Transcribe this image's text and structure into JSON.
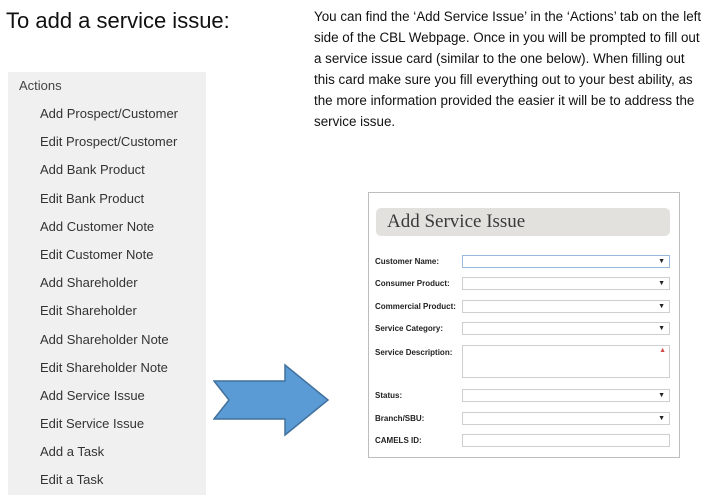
{
  "heading": "To add a service issue:",
  "intro": "You can find the ‘Add Service Issue’ in the ‘Actions’ tab on the left side of the CBL Webpage. Once in you will be prompted to fill out a service issue card (similar to the one below). When filling out this card make sure you fill everything out to your best ability, as the more information provided the easier it will be to address the service issue.",
  "actions": {
    "title": "Actions",
    "items": [
      "Add Prospect/Customer",
      "Edit Prospect/Customer",
      "Add Bank Product",
      "Edit Bank Product",
      "Add Customer Note",
      "Edit Customer Note",
      "Add Shareholder",
      "Edit Shareholder",
      "Add Shareholder Note",
      "Edit Shareholder Note",
      "Add Service Issue",
      "Edit Service Issue",
      "Add a Task",
      "Edit a Task"
    ]
  },
  "arrow": {
    "color": "#5b9bd5",
    "icon": "right-arrow-icon"
  },
  "card": {
    "title": "Add Service Issue",
    "fields": {
      "customer_name": "Customer Name:",
      "consumer_product": "Consumer Product:",
      "commercial_product": "Commercial Product:",
      "service_category": "Service Category:",
      "service_description": "Service Description:",
      "status": "Status:",
      "branch_sbu": "Branch/SBU:",
      "camels_id": "CAMELS ID:"
    },
    "dropdown_caret": "▼",
    "required_mark": "▲"
  }
}
